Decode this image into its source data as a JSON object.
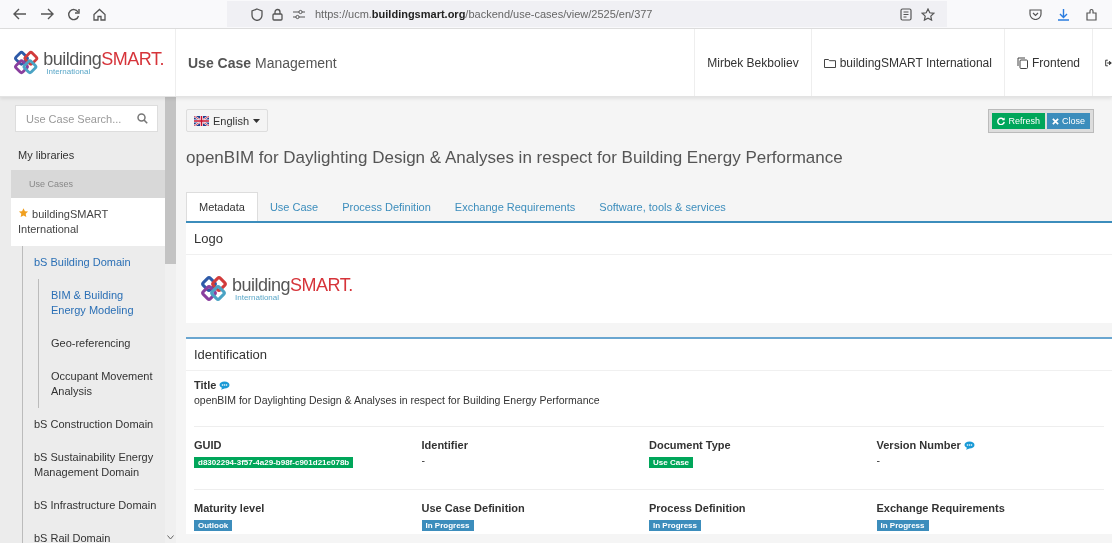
{
  "browser": {
    "url": "https://ucm.**buildingsmart.org**/backend/use-cases/view/2525/en/377"
  },
  "header": {
    "logo": {
      "main": "building",
      "accent": "SMART.",
      "sub": "International"
    },
    "app_title": "**Use Case** Management",
    "nav": [
      {
        "label": "Mirbek Bekboliev",
        "kind": "plain"
      },
      {
        "label": "buildingSMART International",
        "kind": "folder"
      },
      {
        "label": "Frontend",
        "kind": "copy"
      },
      {
        "kind": "logout"
      }
    ]
  },
  "sidebar": {
    "search": {
      "placeholder": "Use Case Search..."
    },
    "my_libraries": "My libraries",
    "section": "Use Cases",
    "tree": [
      {
        "label": "buildingSMART International",
        "starred": true,
        "selected": false,
        "children": [
          {
            "label": "bS Building Domain",
            "selected": false,
            "children": [
              {
                "label": "BIM & Building Energy Modeling",
                "selected": true
              },
              {
                "label": "Geo-referencing",
                "selected": false
              },
              {
                "label": "Occupant Movement Analysis",
                "selected": false
              }
            ]
          },
          {
            "label": "bS Construction Domain",
            "selected": false
          },
          {
            "label": "bS Sustainability Energy Management Domain",
            "selected": false
          },
          {
            "label": "bS Infrastructure Domain",
            "selected": false
          },
          {
            "label": "bS Rail Domain",
            "selected": false
          }
        ]
      }
    ]
  },
  "main": {
    "language": "English",
    "buttons": [
      {
        "label": "Refresh",
        "kind": "refresh"
      },
      {
        "label": "Close",
        "kind": "close"
      }
    ],
    "title": "openBIM for Daylighting Design & Analyses in respect for Building Energy Performance",
    "tabs": [
      {
        "label": "Metadata",
        "selected": true
      },
      {
        "label": "Use Case",
        "selected": false
      },
      {
        "label": "Process Definition",
        "selected": false
      },
      {
        "label": "Exchange Requirements",
        "selected": false
      },
      {
        "label": "Software, tools & services",
        "selected": false
      }
    ],
    "logo_panel": {
      "heading": "Logo",
      "logo": {
        "main": "building",
        "accent": "SMART.",
        "sub": "International"
      }
    },
    "identification": {
      "heading": "Identification",
      "title_field": {
        "label": "Title",
        "comment": true,
        "value": "openBIM for Daylighting Design & Analyses in respect for Building Energy Performance"
      },
      "rows": [
        [
          {
            "label": "GUID",
            "comment": false,
            "kind": "badge",
            "value": "d8302294-3f57-4a29-b98f-c901d21e078b",
            "color": "#00a65a"
          },
          {
            "label": "Identifier",
            "comment": false,
            "kind": "text",
            "value": "-"
          },
          {
            "label": "Document Type",
            "comment": false,
            "kind": "badge",
            "value": "Use Case",
            "color": "#00a65a"
          },
          {
            "label": "Version Number",
            "comment": true,
            "kind": "text",
            "value": "-"
          }
        ],
        [
          {
            "label": "Maturity level",
            "comment": false,
            "kind": "badge",
            "value": "Outlook",
            "color": "#3c8dbc"
          },
          {
            "label": "Use Case Definition",
            "comment": false,
            "kind": "badge",
            "value": "In Progress",
            "color": "#3c8dbc"
          },
          {
            "label": "Process Definition",
            "comment": false,
            "kind": "badge",
            "value": "In Progress",
            "color": "#3c8dbc"
          },
          {
            "label": "Exchange Requirements",
            "comment": false,
            "kind": "badge",
            "value": "In Progress",
            "color": "#3c8dbc"
          }
        ]
      ]
    }
  }
}
